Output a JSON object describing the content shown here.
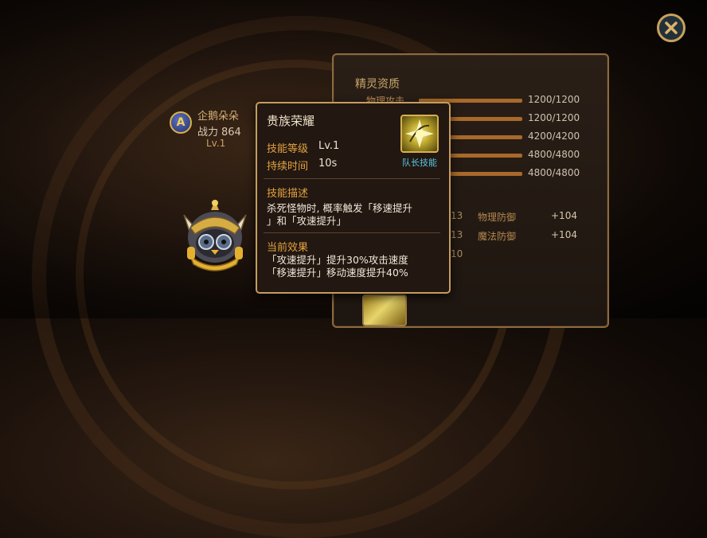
{
  "close_button": {
    "icon": "close-icon"
  },
  "character": {
    "badge_letter": "A",
    "name": "企鹅朵朵",
    "power_label": "战力",
    "power_value": "864",
    "level": "Lv.1"
  },
  "stats_panel": {
    "title": "精灵资质",
    "first_label": "物理攻击",
    "bars": [
      {
        "value": "1200/1200",
        "fill": 1.0
      },
      {
        "value": "1200/1200",
        "fill": 1.0
      },
      {
        "value": "4200/4200",
        "fill": 1.0
      },
      {
        "value": "4800/4800",
        "fill": 1.0
      },
      {
        "value": "4800/4800",
        "fill": 1.0
      }
    ],
    "sub_stats": [
      {
        "left": "13",
        "label": "物理防御",
        "bonus": "+104"
      },
      {
        "left": "13",
        "label": "魔法防御",
        "bonus": "+104"
      },
      {
        "left": "10",
        "label": "",
        "bonus": ""
      }
    ]
  },
  "tooltip": {
    "title": "贵族荣耀",
    "skill_level_label": "技能等级",
    "skill_level_value": "Lv.1",
    "duration_label": "持续时间",
    "duration_value": "10s",
    "icon": "skill-icon",
    "tag": "队长技能",
    "description_title": "技能描述",
    "description_lines": [
      "杀死怪物时, 概率触发「移速提升",
      "」和「攻速提升」"
    ],
    "effect_title": "当前效果",
    "effect_lines": [
      "「攻速提升」提升30%攻击速度",
      "「移速提升」移动速度提升40%"
    ]
  },
  "colors": {
    "accent_gold": "#c59c5e",
    "tag_blue": "#59c6e3",
    "label_orange": "#e3a33f"
  }
}
